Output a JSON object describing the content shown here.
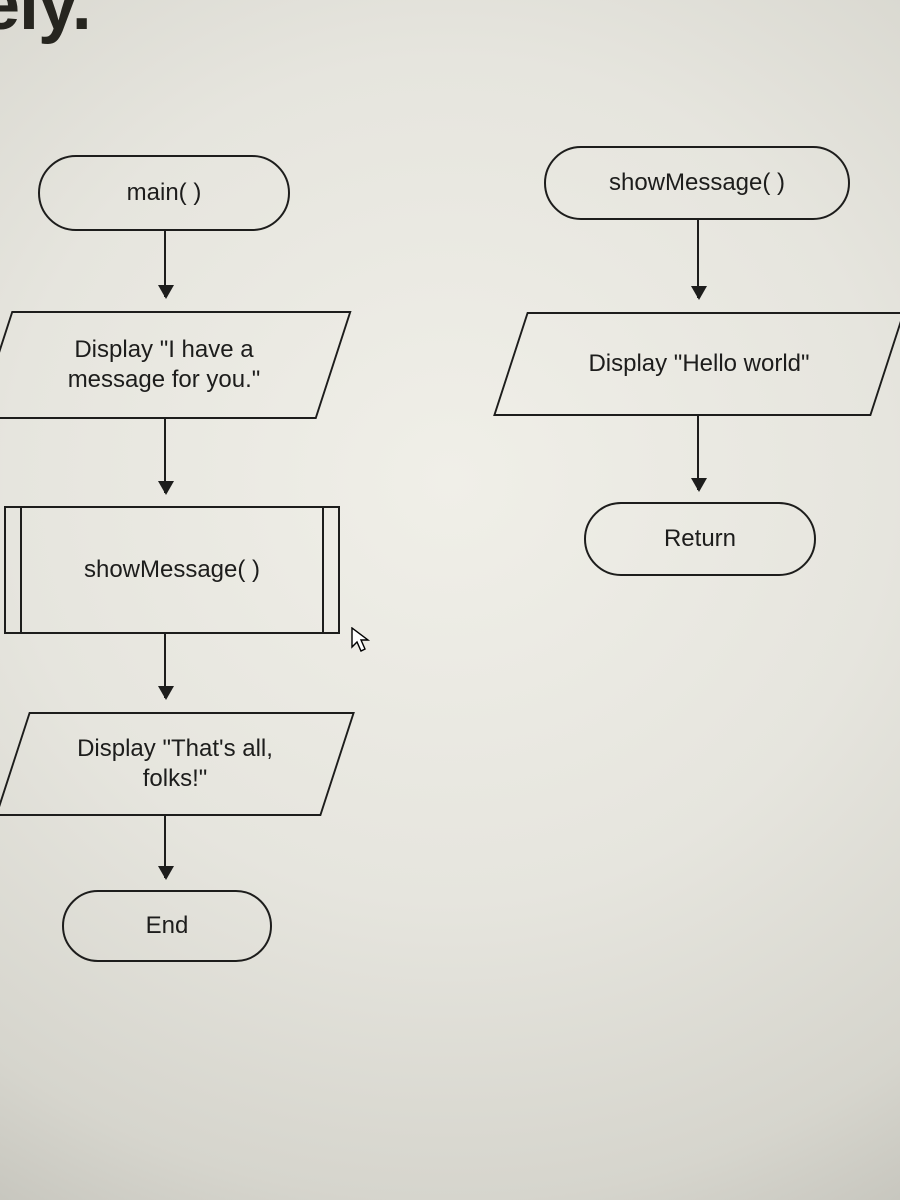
{
  "header": {
    "fragment": "ely."
  },
  "flow": {
    "main": {
      "start": "main( )",
      "display1": "Display \"I have a\nmessage for you.\"",
      "call": "showMessage( )",
      "display2": "Display \"That's all,\nfolks!\"",
      "end": "End"
    },
    "showMessage": {
      "start": "showMessage( )",
      "display": "Display \"Hello world\"",
      "end": "Return"
    }
  },
  "chart_data": {
    "type": "flowchart",
    "functions": [
      {
        "name": "main",
        "nodes": [
          {
            "id": "m0",
            "shape": "terminator",
            "text": "main( )"
          },
          {
            "id": "m1",
            "shape": "io",
            "text": "Display \"I have a message for you.\""
          },
          {
            "id": "m2",
            "shape": "predefined-process",
            "text": "showMessage( )"
          },
          {
            "id": "m3",
            "shape": "io",
            "text": "Display \"That's all, folks!\""
          },
          {
            "id": "m4",
            "shape": "terminator",
            "text": "End"
          }
        ],
        "edges": [
          [
            "m0",
            "m1"
          ],
          [
            "m1",
            "m2"
          ],
          [
            "m2",
            "m3"
          ],
          [
            "m3",
            "m4"
          ]
        ]
      },
      {
        "name": "showMessage",
        "nodes": [
          {
            "id": "s0",
            "shape": "terminator",
            "text": "showMessage( )"
          },
          {
            "id": "s1",
            "shape": "io",
            "text": "Display \"Hello world\""
          },
          {
            "id": "s2",
            "shape": "terminator",
            "text": "Return"
          }
        ],
        "edges": [
          [
            "s0",
            "s1"
          ],
          [
            "s1",
            "s2"
          ]
        ]
      }
    ]
  }
}
